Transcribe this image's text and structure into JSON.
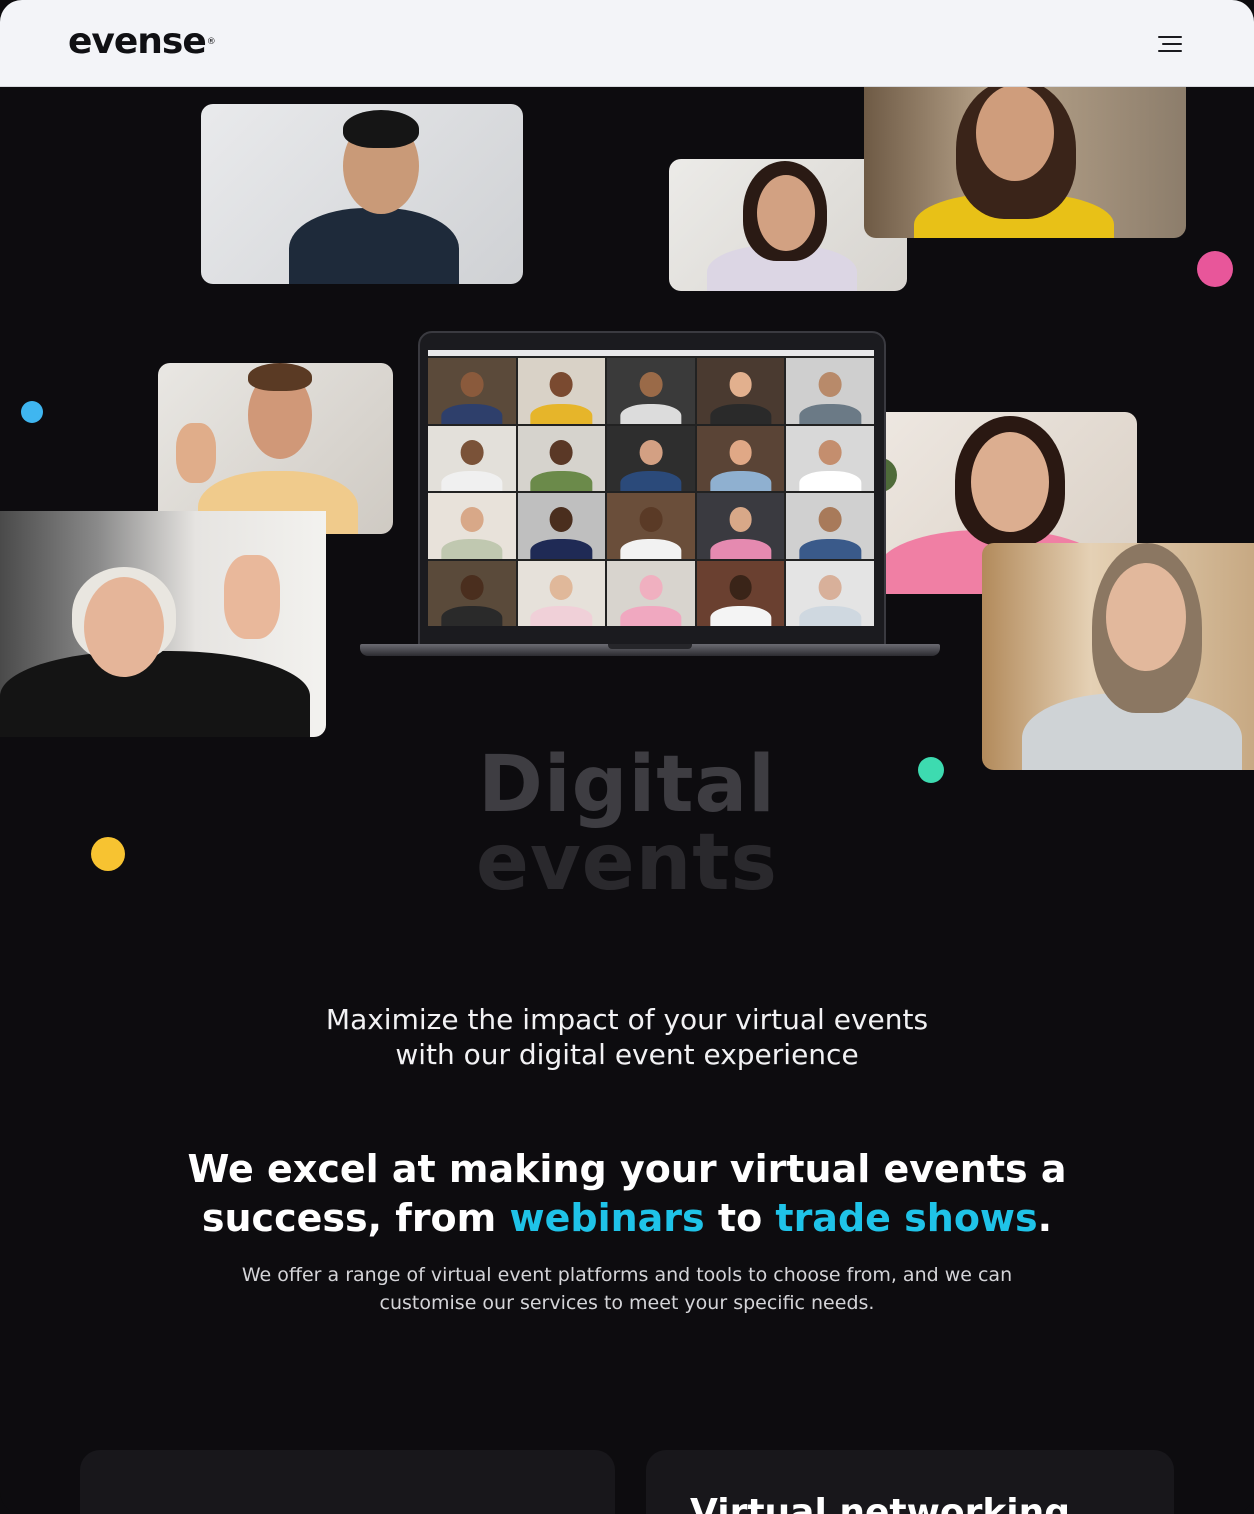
{
  "header": {
    "logo_text": "evense",
    "logo_mark": "®",
    "menu_icon": "hamburger-icon"
  },
  "hero": {
    "title_line1": "Digital",
    "title_line2": "events"
  },
  "intro": {
    "subtitle": "Maximize the impact of your virtual events\nwith our digital event experience"
  },
  "mission": {
    "headline_part1": "We excel at making your virtual events a success, from ",
    "highlight1": "webinars",
    "headline_part2": " to ",
    "highlight2": "trade shows",
    "headline_end": ".",
    "body": "We offer a range of virtual event platforms and tools to choose from, and we can customise our services to meet your specific needs."
  },
  "cards": [
    {
      "title": ""
    },
    {
      "title": "Virtual networking"
    }
  ],
  "colors": {
    "accent": "#1fc3e8",
    "dot_pink": "#e8569a",
    "dot_blue": "#3fb6f0",
    "dot_teal": "#3ddbb0",
    "dot_yellow": "#f7c331"
  }
}
